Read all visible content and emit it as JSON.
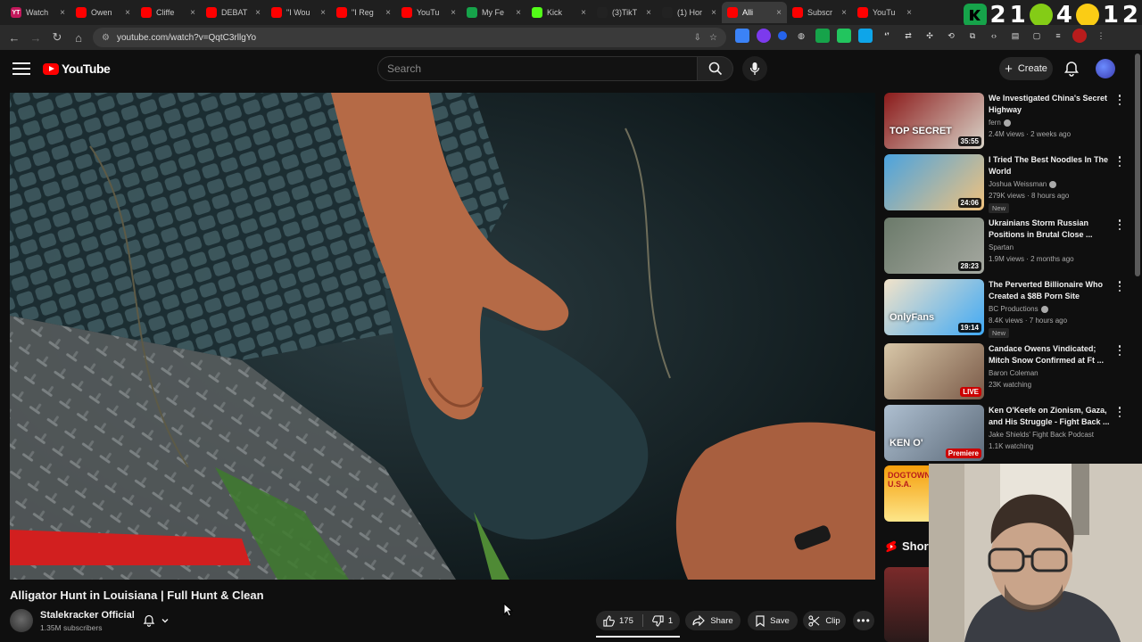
{
  "browser": {
    "tabs": [
      {
        "label": "Watch",
        "color": "#ff0000"
      },
      {
        "label": "Owen",
        "color": "#ff0000"
      },
      {
        "label": "Cliffe",
        "color": "#ff0000"
      },
      {
        "label": "DEBAT",
        "color": "#ff0000"
      },
      {
        "label": "\"I Wou",
        "color": "#ff0000"
      },
      {
        "label": "\"I Reg",
        "color": "#ff0000"
      },
      {
        "label": "YouTu",
        "color": "#ff0000"
      },
      {
        "label": "My Fe",
        "color": "#16a34a"
      },
      {
        "label": "Kick",
        "color": "#53fc18"
      },
      {
        "label": "(3)TikT",
        "color": "#222222"
      },
      {
        "label": "(1) Hor",
        "color": "#222222"
      },
      {
        "label": "Alli",
        "color": "#ff0000"
      },
      {
        "label": "Subscr",
        "color": "#ff0000"
      },
      {
        "label": "YouTu",
        "color": "#ff0000"
      }
    ],
    "first_tab_badge": "YT",
    "overlay_numbers": [
      "2",
      "1",
      "4",
      "1",
      "2"
    ],
    "url": "youtube.com/watch?v=QqtC3rllgYo"
  },
  "header": {
    "logo_text": "YouTube",
    "search_placeholder": "Search",
    "create_label": "Create"
  },
  "video": {
    "title": "Alligator Hunt in Louisiana | Full Hunt & Clean",
    "channel": "Stalekracker Official",
    "subscribers": "1.35M subscribers",
    "likes": "175",
    "dislikes": "1",
    "share_label": "Share",
    "save_label": "Save",
    "clip_label": "Clip"
  },
  "recommendations": [
    {
      "title": "We Investigated China's Secret Highway",
      "channel": "fern",
      "meta": "2.4M views · 2 weeks ago",
      "duration": "35:55",
      "thumb_text": "TOP SECRET",
      "badge": ""
    },
    {
      "title": "I Tried The Best Noodles In The World",
      "channel": "Joshua Weissman",
      "meta": "279K views · 8 hours ago",
      "duration": "24:06",
      "thumb_text": "",
      "badge": "New"
    },
    {
      "title": "Ukrainians Storm Russian Positions in Brutal Close ...",
      "channel": "Spartan",
      "meta": "1.9M views · 2 months ago",
      "duration": "28:23",
      "thumb_text": "",
      "badge": ""
    },
    {
      "title": "The Perverted Billionaire Who Created a $8B Porn Site",
      "channel": "BC Productions",
      "meta": "8.4K views · 7 hours ago",
      "duration": "19:14",
      "thumb_text": "OnlyFans",
      "badge": "New"
    },
    {
      "title": "Candace Owens Vindicated; Mitch Snow Confirmed at Ft ...",
      "channel": "Baron Coleman",
      "meta": "23K watching",
      "duration": "LIVE",
      "thumb_text": "",
      "badge": ""
    },
    {
      "title": "Ken O'Keefe on Zionism, Gaza, and His Struggle - Fight Back ...",
      "channel": "Jake Shields' Fight Back Podcast",
      "meta": "1.1K watching",
      "duration": "Premiere",
      "thumb_text": "KEN O'",
      "badge": ""
    }
  ],
  "shorts": {
    "label": "Shorts",
    "thumb_text": "DOGTOWN U.S.A."
  }
}
